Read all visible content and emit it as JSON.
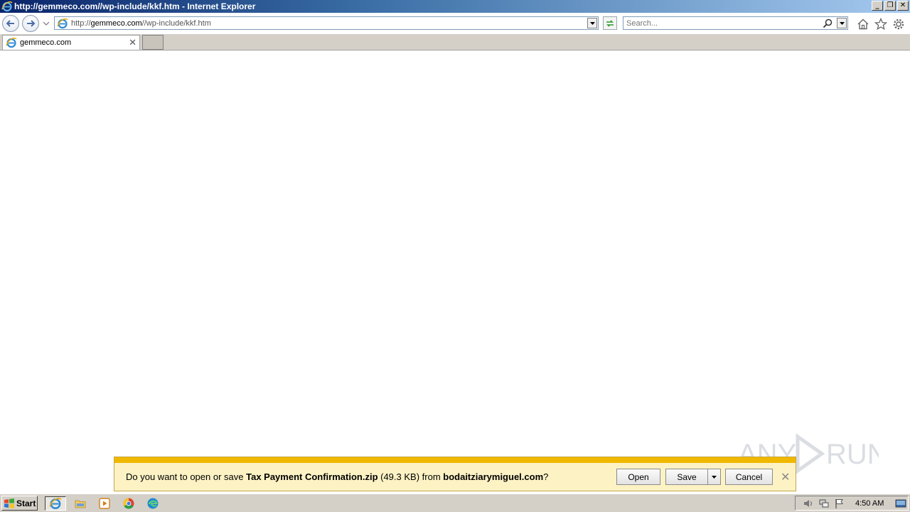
{
  "window": {
    "title": "http://gemmeco.com//wp-include/kkf.htm - Internet Explorer",
    "buttons": [
      "_",
      "❐",
      "✕"
    ]
  },
  "nav": {
    "address_prefix": "http://",
    "address_domain": "gemmeco.com",
    "address_path": "//wp-include/kkf.htm",
    "search_placeholder": "Search..."
  },
  "tabs": [
    {
      "label": "gemmeco.com",
      "close": "✕"
    }
  ],
  "download_bar": {
    "prefix": "Do you want to open or save ",
    "filename": "Tax Payment Confirmation.zip",
    "size": " (49.3 KB) from ",
    "source": "bodaitziarymiguel.com",
    "suffix": "?",
    "open_label": "Open",
    "save_label": "Save",
    "cancel_label": "Cancel",
    "close": "✕",
    "accent_color": "#f0b800"
  },
  "taskbar": {
    "start_label": "Start",
    "clock": "4:50 AM",
    "items": [
      "internet-explorer-icon",
      "file-explorer-icon",
      "media-player-icon",
      "chrome-icon",
      "edge-icon"
    ]
  },
  "watermark": {
    "text": "ANY RUN"
  }
}
